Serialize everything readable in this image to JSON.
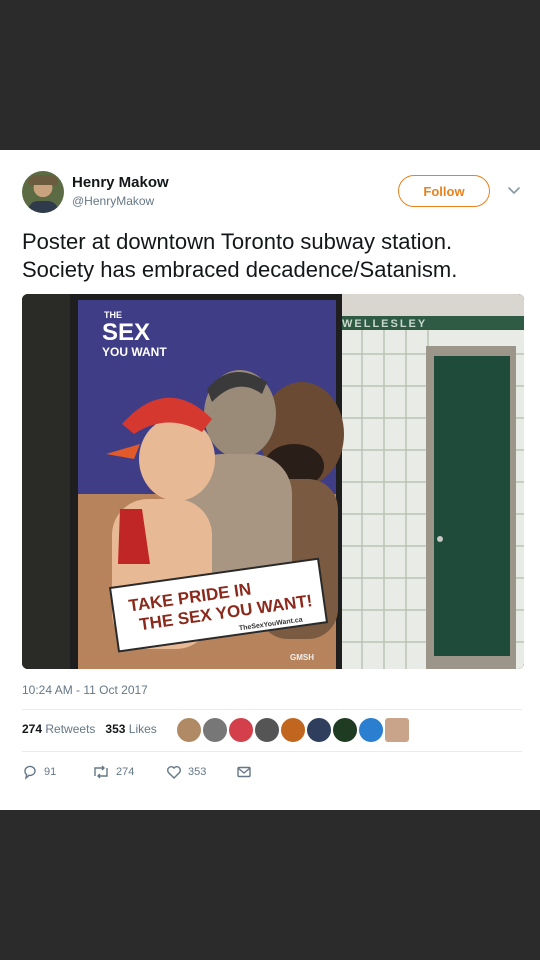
{
  "user": {
    "name": "Henry Makow",
    "handle": "@HenryMakow"
  },
  "follow_label": "Follow",
  "tweet": {
    "line1": "Poster at downtown Toronto subway station.",
    "line2": "Society has embraced decadence/Satanism."
  },
  "poster": {
    "brand_small": "THE",
    "brand_big": "SEX",
    "brand_sub": "YOU WANT",
    "banner_line1": "TAKE PRIDE IN",
    "banner_line2": "THE SEX YOU WANT!",
    "banner_url": "TheSexYouWant.ca",
    "sponsor": "GMSH",
    "station_sign": "WELLESLEY"
  },
  "timestamp": "10:24 AM - 11 Oct 2017",
  "stats": {
    "retweets_count": "274",
    "retweets_label": "Retweets",
    "likes_count": "353",
    "likes_label": "Likes"
  },
  "actions": {
    "reply_count": "91",
    "retweet_count": "274",
    "like_count": "353"
  },
  "colors": {
    "accent": "#e8821e",
    "text": "#14171a",
    "muted": "#657786",
    "frame": "#2b2b2b"
  },
  "icons": [
    "chevron-down-icon",
    "reply-icon",
    "retweet-icon",
    "heart-icon",
    "message-icon"
  ]
}
